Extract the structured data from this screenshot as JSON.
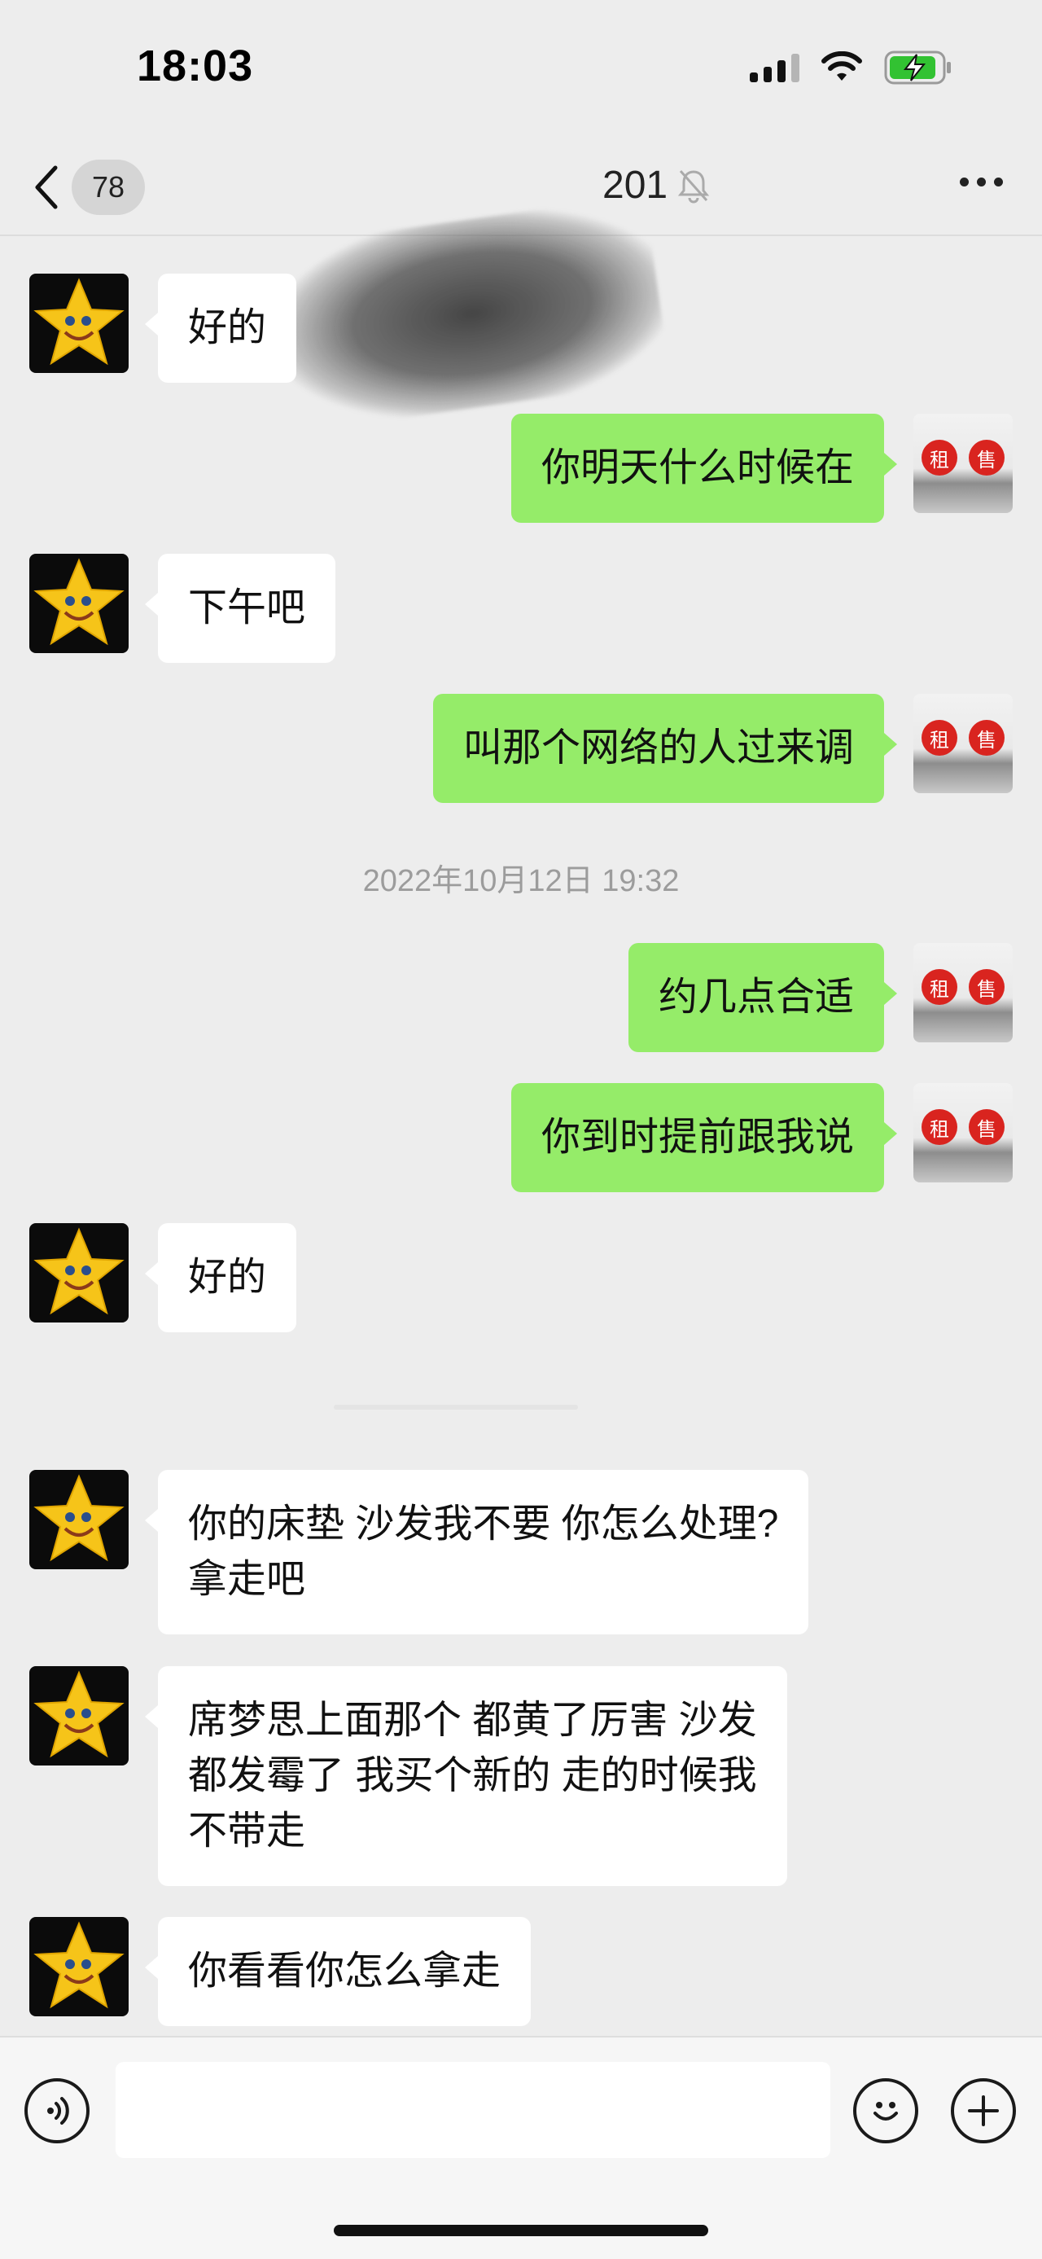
{
  "status_bar": {
    "time": "18:03"
  },
  "header": {
    "unread_count": "78",
    "title": "201"
  },
  "messages": [
    {
      "side": "left",
      "avatar": "star-avatar",
      "text": "好的"
    },
    {
      "side": "right",
      "avatar": "rental-shop-avatar",
      "text": "你明天什么时候在"
    },
    {
      "side": "left",
      "avatar": "star-avatar",
      "text": "下午吧"
    },
    {
      "side": "right",
      "avatar": "rental-shop-avatar",
      "text": "叫那个网络的人过来调"
    },
    {
      "side": "right",
      "avatar": "rental-shop-avatar",
      "text": "约几点合适"
    },
    {
      "side": "right",
      "avatar": "rental-shop-avatar",
      "text": "你到时提前跟我说"
    },
    {
      "side": "left",
      "avatar": "star-avatar",
      "text": "好的"
    },
    {
      "side": "left",
      "avatar": "star-avatar",
      "text": "你的床垫  沙发我不要  你怎么处理?\n拿走吧"
    },
    {
      "side": "left",
      "avatar": "star-avatar",
      "text": "席梦思上面那个  都黄了厉害  沙发\n都发霉了  我买个新的  走的时候我\n不带走"
    },
    {
      "side": "left",
      "avatar": "star-avatar",
      "text": "你看看你怎么拿走"
    }
  ],
  "timestamp": "2022年10月12日 19:32",
  "shop_avatar": {
    "char1": "租",
    "char2": "售"
  },
  "input": {
    "value": "",
    "placeholder": ""
  },
  "colors": {
    "background": "#ededed",
    "sent_bubble": "#95ec69",
    "received_bubble": "#ffffff",
    "battery_charging": "#32c232"
  }
}
